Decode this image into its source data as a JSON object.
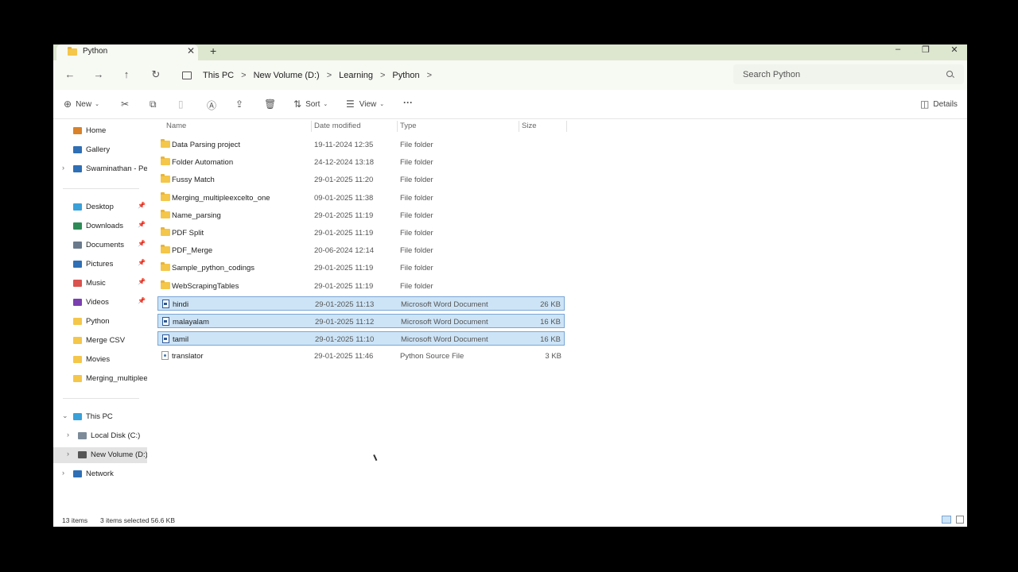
{
  "window": {
    "tab_title": "Python",
    "tab_close": "✕",
    "new_tab": "+",
    "minimize": "–",
    "restore": "❐",
    "close": "✕"
  },
  "nav": {
    "back": "←",
    "forward": "→",
    "up": "↑",
    "refresh": "↻"
  },
  "breadcrumb": [
    "This PC",
    "New Volume (D:)",
    "Learning",
    "Python"
  ],
  "breadcrumb_sep": ">",
  "search": {
    "placeholder": "Search Python"
  },
  "toolbar": {
    "new_label": "New",
    "sort_label": "Sort",
    "view_label": "View",
    "more_label": "···",
    "details_label": "Details"
  },
  "sidebar": {
    "quick": [
      {
        "label": "Home",
        "icon": "home-icon",
        "color": "#d9822b",
        "pinned": false,
        "chevron": false
      },
      {
        "label": "Gallery",
        "icon": "gallery-icon",
        "color": "#2f6fb5",
        "pinned": false,
        "chevron": false
      },
      {
        "label": "Swaminathan - Personal",
        "icon": "cloud-icon",
        "color": "#2f6fb5",
        "pinned": false,
        "chevron": true
      }
    ],
    "pinned": [
      {
        "label": "Desktop",
        "icon": "desktop-icon",
        "color": "#3aa0d8",
        "pinned": true
      },
      {
        "label": "Downloads",
        "icon": "download-icon",
        "color": "#2e8b57",
        "pinned": true
      },
      {
        "label": "Documents",
        "icon": "documents-icon",
        "color": "#6a7a8c",
        "pinned": true
      },
      {
        "label": "Pictures",
        "icon": "pictures-icon",
        "color": "#2f6fb5",
        "pinned": true
      },
      {
        "label": "Music",
        "icon": "music-icon",
        "color": "#d9534f",
        "pinned": true
      },
      {
        "label": "Videos",
        "icon": "videos-icon",
        "color": "#7b3fb0",
        "pinned": true
      },
      {
        "label": "Python",
        "icon": "folder-icon",
        "color": "#f4c64a",
        "pinned": false
      },
      {
        "label": "Merge CSV",
        "icon": "folder-icon",
        "color": "#f4c64a",
        "pinned": false
      },
      {
        "label": "Movies",
        "icon": "folder-icon",
        "color": "#f4c64a",
        "pinned": false
      },
      {
        "label": "Merging_multipleexcelto_one",
        "icon": "folder-icon",
        "color": "#f4c64a",
        "pinned": false
      }
    ],
    "thispc": {
      "label": "This PC",
      "color": "#3aa0d8"
    },
    "drives": [
      {
        "label": "Local Disk (C:)",
        "color": "#7d8b99",
        "selected": false
      },
      {
        "label": "New Volume (D:)",
        "color": "#555555",
        "selected": true
      }
    ],
    "network": {
      "label": "Network",
      "color": "#2f6fb5"
    }
  },
  "columns": {
    "name": "Name",
    "date": "Date modified",
    "type": "Type",
    "size": "Size"
  },
  "files": [
    {
      "name": "Data Parsing project",
      "date": "19-11-2024 12:35",
      "type": "File folder",
      "size": "",
      "kind": "folder",
      "selected": false
    },
    {
      "name": "Folder Automation",
      "date": "24-12-2024 13:18",
      "type": "File folder",
      "size": "",
      "kind": "folder",
      "selected": false
    },
    {
      "name": "Fussy Match",
      "date": "29-01-2025 11:20",
      "type": "File folder",
      "size": "",
      "kind": "folder",
      "selected": false
    },
    {
      "name": "Merging_multipleexcelto_one",
      "date": "09-01-2025 11:38",
      "type": "File folder",
      "size": "",
      "kind": "folder",
      "selected": false
    },
    {
      "name": "Name_parsing",
      "date": "29-01-2025 11:19",
      "type": "File folder",
      "size": "",
      "kind": "folder",
      "selected": false
    },
    {
      "name": "PDF Split",
      "date": "29-01-2025 11:19",
      "type": "File folder",
      "size": "",
      "kind": "folder",
      "selected": false
    },
    {
      "name": "PDF_Merge",
      "date": "20-06-2024 12:14",
      "type": "File folder",
      "size": "",
      "kind": "folder",
      "selected": false
    },
    {
      "name": "Sample_python_codings",
      "date": "29-01-2025 11:19",
      "type": "File folder",
      "size": "",
      "kind": "folder",
      "selected": false
    },
    {
      "name": "WebScrapingTables",
      "date": "29-01-2025 11:19",
      "type": "File folder",
      "size": "",
      "kind": "folder",
      "selected": false
    },
    {
      "name": "hindi",
      "date": "29-01-2025 11:13",
      "type": "Microsoft Word Document",
      "size": "26 KB",
      "kind": "word",
      "selected": true
    },
    {
      "name": "malayalam",
      "date": "29-01-2025 11:12",
      "type": "Microsoft Word Document",
      "size": "16 KB",
      "kind": "word",
      "selected": true
    },
    {
      "name": "tamil",
      "date": "29-01-2025 11:10",
      "type": "Microsoft Word Document",
      "size": "16 KB",
      "kind": "word",
      "selected": true
    },
    {
      "name": "translator",
      "date": "29-01-2025 11:46",
      "type": "Python Source File",
      "size": "3 KB",
      "kind": "python",
      "selected": false
    }
  ],
  "status": {
    "item_count": "13 items",
    "selection": "3 items selected  56.6 KB"
  }
}
